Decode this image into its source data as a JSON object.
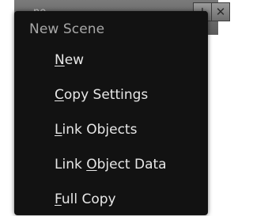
{
  "header": {
    "fragment_text": "ne",
    "plus_icon": "plus-icon",
    "close_icon": "close-icon"
  },
  "menu": {
    "title": "New Scene",
    "items": [
      {
        "mnemonic": "N",
        "rest": "ew"
      },
      {
        "mnemonic": "C",
        "rest": "opy Settings"
      },
      {
        "mnemonic": "L",
        "rest": "ink Objects"
      },
      {
        "pre": "Link ",
        "mnemonic": "O",
        "rest": "bject Data"
      },
      {
        "mnemonic": "F",
        "rest": "ull Copy"
      }
    ]
  }
}
